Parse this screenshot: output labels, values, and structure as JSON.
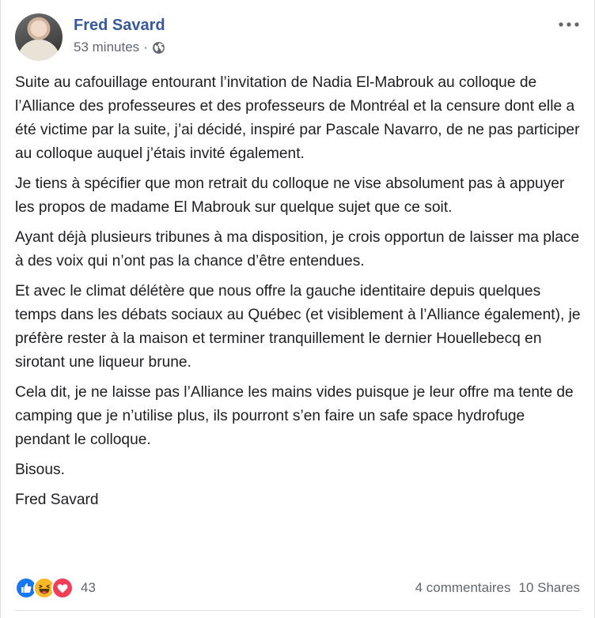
{
  "post": {
    "author": "Fred Savard",
    "timestamp": "53 minutes",
    "separator": "·",
    "privacy_icon": "globe-icon",
    "menu_icon": "more-icon",
    "paragraphs": [
      "Suite au cafouillage entourant l’invitation de Nadia El-Mabrouk au colloque de l’Alliance des professeures et des professeurs de Montréal et la censure dont elle a été victime par la suite, j’ai décidé, inspiré par Pascale Navarro, de ne pas participer au colloque auquel j’étais invité également.",
      "Je tiens à spécifier que mon retrait du colloque ne vise absolument pas à appuyer les propos de madame El Mabrouk sur quelque sujet que ce soit.",
      "Ayant déjà plusieurs tribunes à ma disposition, je crois opportun de laisser ma place à des voix qui n’ont pas la chance d’être entendues.",
      "Et avec le climat délétère que nous offre la gauche identitaire depuis quelques temps dans les débats sociaux au Québec (et visiblement à l’Alliance également), je préfère rester à la maison et terminer tranquillement le dernier Houellebecq en sirotant une liqueur brune.",
      "Cela dit, je ne laisse pas l’Alliance les mains vides puisque je leur offre ma tente de camping que je n’utilise plus, ils pourront s’en faire un safe space hydrofuge pendant le colloque.",
      "Bisous.",
      "Fred Savard"
    ]
  },
  "footer": {
    "reactions": [
      "like-icon",
      "haha-icon",
      "love-icon"
    ],
    "reaction_count": "43",
    "comments": "4 commentaires",
    "shares": "10 Shares"
  },
  "colors": {
    "author": "#385898",
    "secondary_text": "#606770",
    "like": "#1877f2",
    "haha": "#f7b928",
    "love": "#f33e58"
  }
}
